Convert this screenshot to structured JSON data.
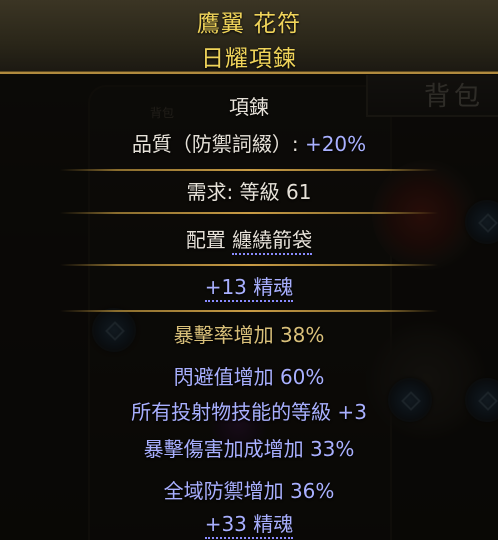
{
  "header": {
    "name_line": "鷹翼 花符",
    "base_line": "日耀項鍊"
  },
  "background": {
    "inventory_title": "背包",
    "small_label": "背包"
  },
  "tooltip": {
    "item_class": "項鍊",
    "quality_label": "品質（防禦詞綴）: ",
    "quality_value": "+20%",
    "requirement_label": "需求: 等級 ",
    "requirement_value": "61",
    "config_label": "配置 ",
    "config_value": "纏繞箭袋",
    "implicit_mod": "+13 精魂",
    "enchant_mod": "暴擊率增加 38%",
    "explicit_mods": [
      "閃避值增加 60%",
      "所有投射物技能的等級 +3",
      "暴擊傷害加成增加 33%",
      "全域防禦增加 36%",
      "+33 精魂"
    ]
  },
  "colors": {
    "header_text": "#f0d45a",
    "magic_mod": "#a9b0ff",
    "enchant": "#d9c07a",
    "separator": "#c89b45"
  }
}
